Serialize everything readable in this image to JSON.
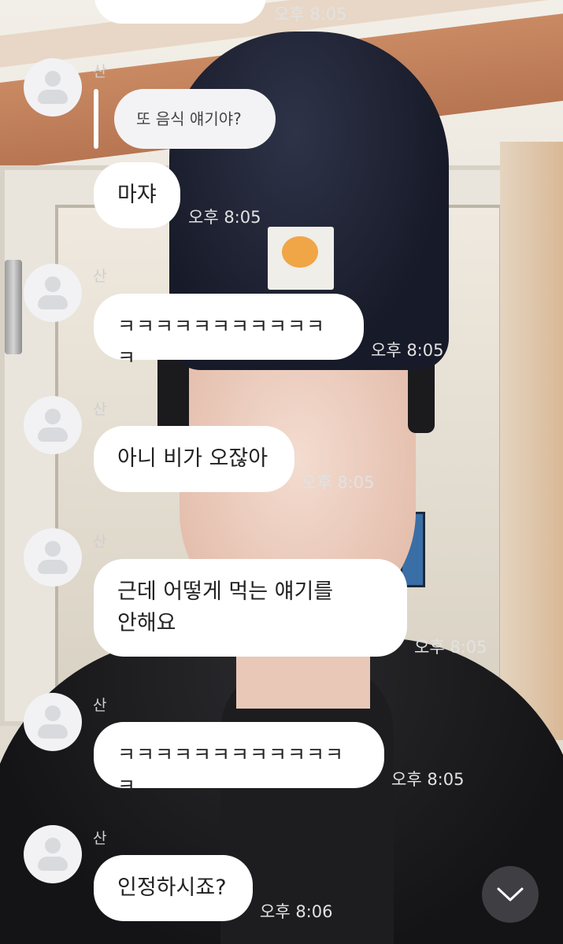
{
  "messages": [
    {
      "sender": "산",
      "quote": "또 음식 얘기야?",
      "text": "마쟈",
      "time": "오후 8:05"
    },
    {
      "sender": "산",
      "text": "ㅋㅋㅋㅋㅋㅋㅋㅋㅋㅋㅋㅋ",
      "time": "오후 8:05"
    },
    {
      "sender": "산",
      "text": "아니 비가 오잖아",
      "time": "오후 8:05"
    },
    {
      "sender": "산",
      "text": "근데 어떻게 먹는 얘기를\n안해요",
      "time": "오후 8:05"
    },
    {
      "sender": "산",
      "text": "ㅋㅋㅋㅋㅋㅋㅋㅋㅋㅋㅋㅋㅋ",
      "time": "오후 8:05"
    },
    {
      "sender": "산",
      "text": "인정하시죠?",
      "time": "오후 8:06"
    }
  ],
  "top_partial": {
    "time": "오후 8:05"
  },
  "scroll_button": {
    "icon": "chevron-down-icon"
  },
  "colors": {
    "bubble": "#ffffff",
    "quote_bubble": "#f3f3f5",
    "time_text": "#e2e2e2",
    "scroll_button": "#46464b"
  }
}
